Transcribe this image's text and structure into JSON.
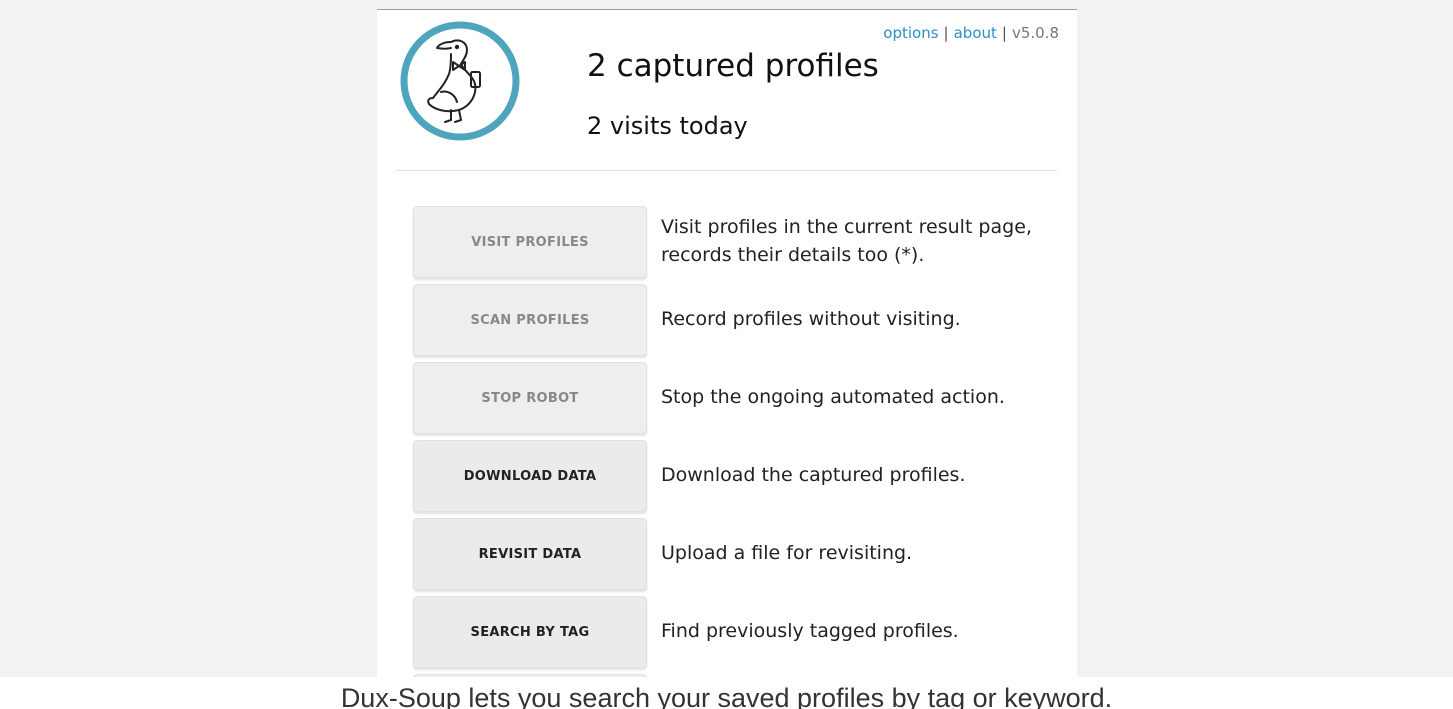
{
  "header": {
    "options_label": "options",
    "about_label": "about",
    "version": "v5.0.8",
    "separator": "|",
    "title": "2 captured profiles",
    "subtitle": "2 visits today"
  },
  "logo": {
    "icon": "duck-logo-icon",
    "ring_color": "#4ea3bd"
  },
  "actions": [
    {
      "label": "VISIT PROFILES",
      "description": "Visit profiles in the current result page, records their details too (*).",
      "enabled": false
    },
    {
      "label": "SCAN PROFILES",
      "description": "Record profiles without visiting.",
      "enabled": false
    },
    {
      "label": "STOP ROBOT",
      "description": "Stop the ongoing automated action.",
      "enabled": false
    },
    {
      "label": "DOWNLOAD DATA",
      "description": "Download the captured profiles.",
      "enabled": true
    },
    {
      "label": "REVISIT DATA",
      "description": "Upload a file for revisiting.",
      "enabled": true
    },
    {
      "label": "SEARCH BY TAG",
      "description": "Find previously tagged profiles.",
      "enabled": true
    }
  ],
  "caption": "Dux-Soup lets you search your saved profiles by tag or keyword.",
  "colors": {
    "link": "#2a8fc8",
    "button_bg": "#eeeeee",
    "disabled_text": "#888888"
  }
}
